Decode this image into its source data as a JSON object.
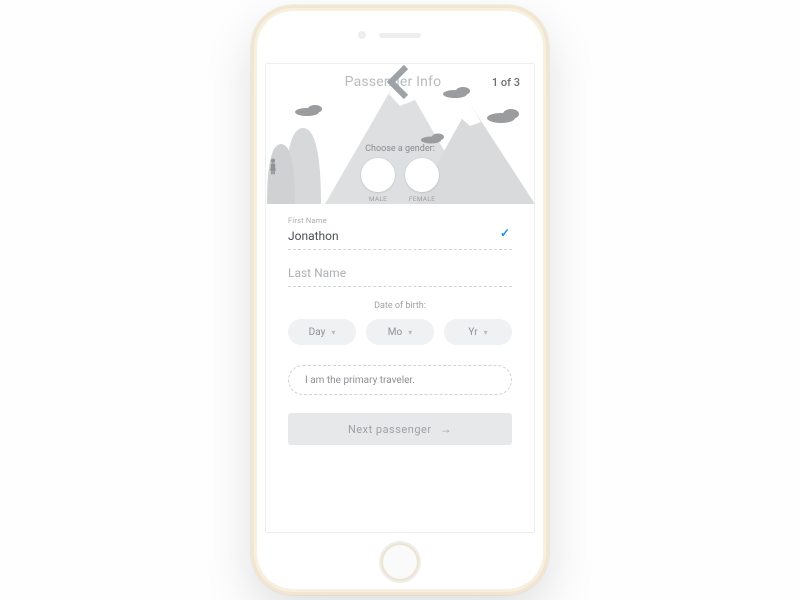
{
  "header": {
    "title": "Passenger Info",
    "step": "1 of 3"
  },
  "gender": {
    "prompt": "Choose a gender:",
    "options": [
      {
        "label": "MALE"
      },
      {
        "label": "FEMALE"
      }
    ]
  },
  "fields": {
    "first_name_label": "First Name",
    "first_name_value": "Jonathon",
    "last_name_label": "Last Name",
    "last_name_value": ""
  },
  "dob": {
    "label": "Date of birth:",
    "day": "Day",
    "month": "Mo",
    "year": "Yr"
  },
  "primary_traveler": "I am the primary traveler.",
  "next_button": "Next passenger"
}
